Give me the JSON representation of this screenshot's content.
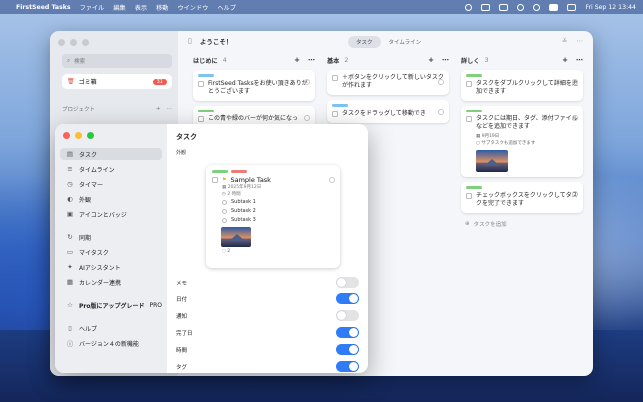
{
  "menubar": {
    "app": "FirstSeed Tasks",
    "items": [
      "ファイル",
      "編集",
      "表示",
      "移動",
      "ウインドウ",
      "ヘルプ"
    ],
    "clock": "Fri Sep 12  13:44"
  },
  "main_window": {
    "sidebar": {
      "search_placeholder": "検索",
      "trash_label": "ゴミ箱",
      "trash_count": "31",
      "projects_label": "プロジェクト"
    },
    "toolbar": {
      "title": "ようこそ！",
      "view_tabs": [
        "タスク",
        "タイムライン"
      ]
    },
    "columns": [
      {
        "title": "はじめに",
        "count": "4",
        "cards": [
          {
            "tags": [
              "#7cc3f2"
            ],
            "text": "FirstSeed Tasksをお使い頂きありがとうございます"
          },
          {
            "tags": [
              "#7ed07a"
            ],
            "text": "この青や緑のバーが何か気になっ"
          }
        ]
      },
      {
        "title": "基本",
        "count": "2",
        "cards": [
          {
            "tags": [],
            "text": "＋ボタンをクリックして新しいタスクが作れます"
          },
          {
            "tags": [
              "#7cc3f2"
            ],
            "text": "タスクをドラッグして移動でき"
          }
        ]
      },
      {
        "title": "詳しく",
        "count": "3",
        "cards": [
          {
            "tags": [
              "#7ed07a"
            ],
            "text": "タスクをダブルクリックして詳細を追加できます"
          },
          {
            "tags": [
              "#7ed07a"
            ],
            "text": "タスクには期日、タグ、添付ファイルなどを追加できます",
            "meta": [
              "9月19日",
              "サブタスクも追加できます"
            ],
            "image": true
          },
          {
            "tags": [
              "#7ed07a"
            ],
            "text": "チェックボックスをクリックしてタスクを完了できます"
          }
        ],
        "add_task": "タスクを追加"
      }
    ]
  },
  "settings": {
    "nav": [
      {
        "icon": "task-list-icon",
        "glyph": "▤",
        "label": "タスク",
        "active": true
      },
      {
        "icon": "timeline-icon",
        "glyph": "≡",
        "label": "タイムライン"
      },
      {
        "icon": "timer-icon",
        "glyph": "◷",
        "label": "タイマー"
      },
      {
        "icon": "appearance-icon",
        "glyph": "◐",
        "label": "外観"
      },
      {
        "icon": "icons-badge-icon",
        "glyph": "▣",
        "label": "アイコンとバッジ"
      },
      {
        "icon": "sync-icon",
        "glyph": "↻",
        "label": "同期"
      },
      {
        "icon": "my-tasks-icon",
        "glyph": "▭",
        "label": "マイタスク"
      },
      {
        "icon": "ai-assistant-icon",
        "glyph": "✦",
        "label": "AIアシスタント"
      },
      {
        "icon": "calendar-icon",
        "glyph": "▦",
        "label": "カレンダー連携"
      },
      {
        "icon": "star-icon",
        "glyph": "☆",
        "label": "Pro版にアップグレード",
        "badge": "PRO"
      },
      {
        "icon": "help-book-icon",
        "glyph": "▯",
        "label": "ヘルプ"
      },
      {
        "icon": "info-icon",
        "glyph": "ⓘ",
        "label": "バージョン４の新機能"
      }
    ],
    "title": "タスク",
    "section_label": "外観",
    "preview": {
      "tag_colors": [
        "#7ed07a",
        "#f07a7a"
      ],
      "task_title": "Sample Task",
      "date": "2025年9月12日",
      "duration": "2 時間",
      "subtasks": [
        "Subtask 1",
        "Subtask 2",
        "Subtask 3"
      ],
      "comments": "2"
    },
    "toggles": [
      {
        "label": "メモ",
        "on": false
      },
      {
        "label": "日付",
        "on": true
      },
      {
        "label": "通知",
        "on": false
      },
      {
        "label": "完了日",
        "on": true
      },
      {
        "label": "時間",
        "on": true
      },
      {
        "label": "タグ",
        "on": true
      }
    ]
  }
}
